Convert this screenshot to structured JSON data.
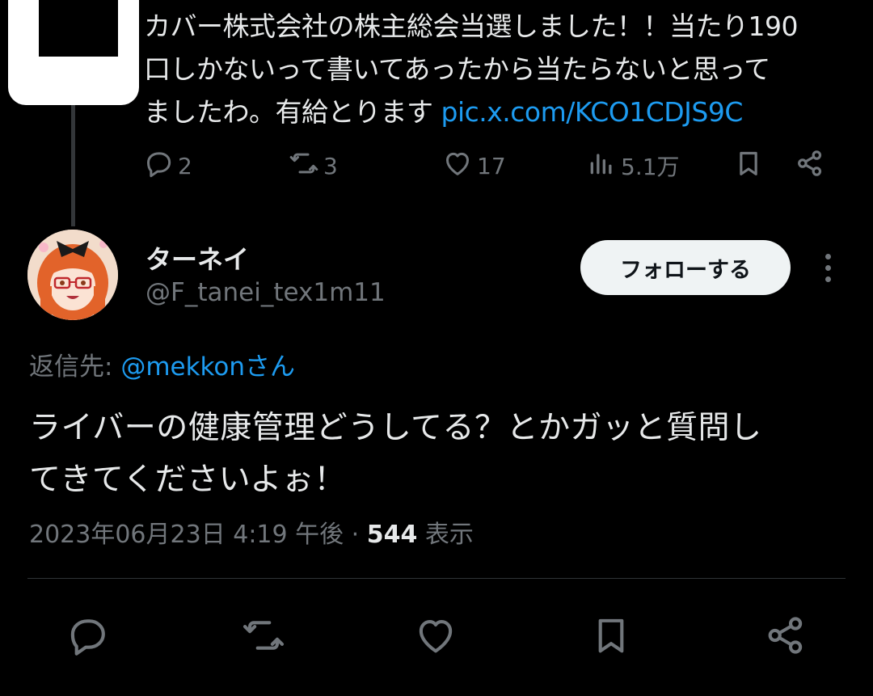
{
  "parent_tweet": {
    "text_line1": "カバー株式会社の株主総会当選しました！！当たり190",
    "text_line2": "口しかないって書いてあったから当たらないと思って",
    "text_line3": "ましたわ。有給とります ",
    "link": "pic.x.com/KCO1CDJS9C",
    "actions": {
      "replies": "2",
      "retweets": "3",
      "likes": "17",
      "views": "5.1万"
    }
  },
  "tweet": {
    "display_name": "ターネイ",
    "handle": "@F_tanei_tex1m11",
    "follow_label": "フォローする",
    "reply_prefix": "返信先: ",
    "reply_mention": "@mekkonさん",
    "text_line1": "ライバーの健康管理どうしてる？とかガッと質問し",
    "text_line2": "てきてくださいよぉ！",
    "timestamp": "2023年06月23日 4:19 午後 · ",
    "views_count": "544",
    "views_label": " 表示"
  },
  "icons": {
    "reply": "reply-icon",
    "retweet": "retweet-icon",
    "like": "heart-icon",
    "views": "views-icon",
    "bookmark": "bookmark-icon",
    "share": "share-icon",
    "more": "more-icon"
  },
  "colors": {
    "background": "#000000",
    "text": "#e7e9ea",
    "muted": "#71767b",
    "link": "#1d9bf0",
    "follow_bg": "#eff3f4"
  }
}
